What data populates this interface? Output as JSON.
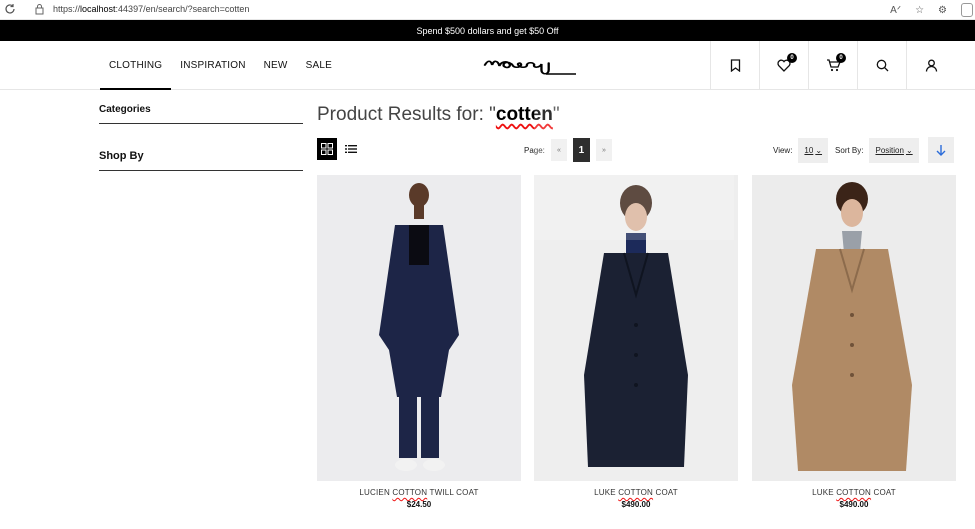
{
  "browser": {
    "url_prefix": "https://",
    "url_host": "localhost",
    "url_rest": ":44397/en/search/?search=cotten"
  },
  "promo": {
    "text": "Spend $500 dollars and get $50 Off"
  },
  "header": {
    "nav": [
      "CLOTHING",
      "INSPIRATION",
      "NEW",
      "SALE"
    ],
    "active_nav": "CLOTHING",
    "logo_text": "mosey",
    "wishlist_count": "0",
    "cart_count": "0"
  },
  "sidebar": {
    "categories_title": "Categories",
    "shop_by_title": "Shop By"
  },
  "results": {
    "prefix": "Product Results for: \"",
    "term": "cotten",
    "suffix": "\""
  },
  "toolbar": {
    "page_label": "Page:",
    "prev_arrow": "«",
    "current_page": "1",
    "next_arrow": "»",
    "view_label": "View:",
    "view_value": "10",
    "sort_label": "Sort By:",
    "sort_value": "Position"
  },
  "products": [
    {
      "name_before": "LUCIEN ",
      "name_hl": "COTTON",
      "name_after": " TWILL COAT",
      "price": "$24.50",
      "coat_color": "#1d2547",
      "bg": "#ededee"
    },
    {
      "name_before": "LUKE ",
      "name_hl": "COTTON",
      "name_after": " COAT",
      "price": "$490.00",
      "coat_color": "#1b2133",
      "bg": "#eeeeee"
    },
    {
      "name_before": "LUKE ",
      "name_hl": "COTTON",
      "name_after": " COAT",
      "price": "$490.00",
      "coat_color": "#b08a65",
      "bg": "#ececec"
    }
  ],
  "colors": {
    "accent": "#000000",
    "highlight": "#e11111",
    "sort_arrow": "#2b6cd9"
  }
}
